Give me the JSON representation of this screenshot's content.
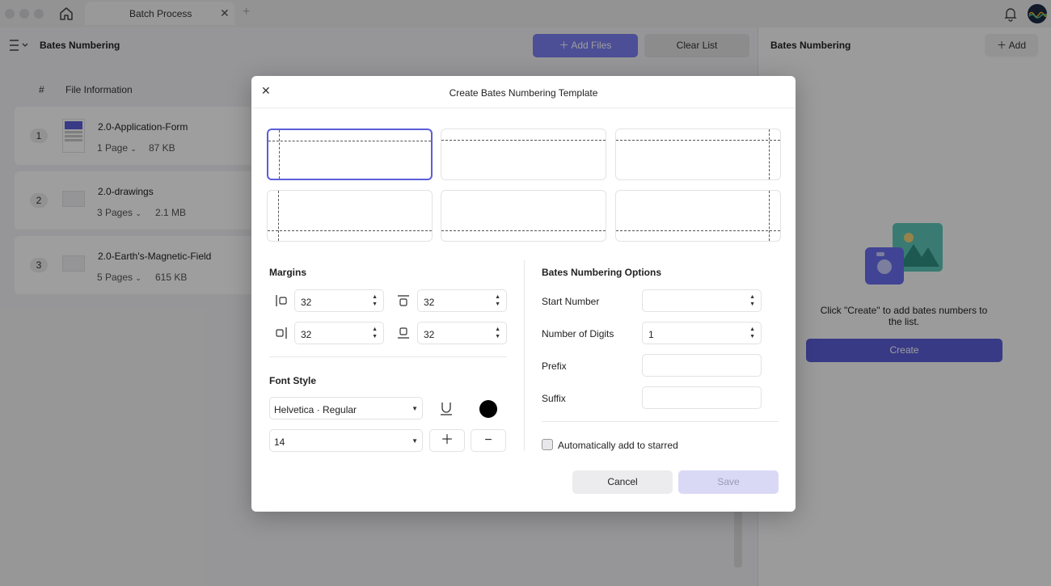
{
  "tab": {
    "title": "Batch Process"
  },
  "left": {
    "title": "Bates Numbering",
    "add_files_label": "Add Files",
    "clear_list_label": "Clear List",
    "columns": {
      "hash": "#",
      "info": "File Information"
    },
    "files": [
      {
        "num": "1",
        "name": "2.0-Application-Form",
        "pages": "1 Page",
        "size": "87 KB"
      },
      {
        "num": "2",
        "name": "2.0-drawings",
        "pages": "3 Pages",
        "size": "2.1 MB"
      },
      {
        "num": "3",
        "name": "2.0-Earth's-Magnetic-Field",
        "pages": "5 Pages",
        "size": "615 KB"
      }
    ]
  },
  "right": {
    "title": "Bates Numbering",
    "add_label": "Add",
    "message": "Click \"Create\" to add bates numbers to the list.",
    "create_label": "Create"
  },
  "dialog": {
    "title": "Create Bates Numbering Template",
    "close_icon": "close-icon",
    "margins": {
      "title": "Margins",
      "left": "32",
      "top": "32",
      "right": "32",
      "bottom": "32"
    },
    "font": {
      "title": "Font Style",
      "family": "Helvetica · Regular",
      "size": "14",
      "color": "#000000"
    },
    "options": {
      "title": "Bates Numbering Options",
      "start_number_label": "Start Number",
      "start_number_value": "",
      "digits_label": "Number of Digits",
      "digits_value": "1",
      "prefix_label": "Prefix",
      "prefix_value": "",
      "suffix_label": "Suffix",
      "suffix_value": "",
      "starred_label": "Automatically add to starred",
      "starred_checked": false
    },
    "cancel_label": "Cancel",
    "save_label": "Save"
  },
  "colors": {
    "accent": "#5b5ed8",
    "add_files": "#7b7ff2"
  }
}
